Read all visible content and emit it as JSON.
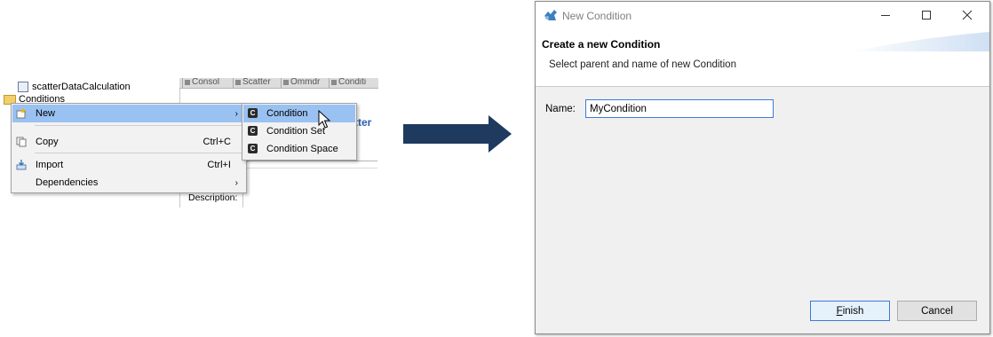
{
  "tree": {
    "item_scatter": "scatterDataCalculation",
    "item_conditions": "Conditions"
  },
  "editor": {
    "tabs": [
      "Consol",
      "Scatter",
      "Ommdr",
      "Conditi"
    ],
    "edge_text": "tter",
    "description_label": "Description:"
  },
  "context_menu": {
    "new_label": "New",
    "copy_label": "Copy",
    "copy_shortcut": "Ctrl+C",
    "import_label": "Import",
    "import_shortcut": "Ctrl+I",
    "dependencies_label": "Dependencies"
  },
  "submenu": {
    "items": [
      "Condition",
      "Condition Set",
      "Condition Space"
    ],
    "icon_letter": "C"
  },
  "dialog": {
    "title": "New Condition",
    "header_title": "Create a new Condition",
    "header_message": "Select parent and name of new Condition",
    "name_label": "Name:",
    "name_value": "MyCondition",
    "finish_mnemonic": "F",
    "finish_rest": "inish",
    "cancel_label": "Cancel"
  },
  "colors": {
    "menu_highlight": "#99c1f1",
    "arrow_fill": "#1f3a5f",
    "focus_border": "#3c7bd6"
  }
}
